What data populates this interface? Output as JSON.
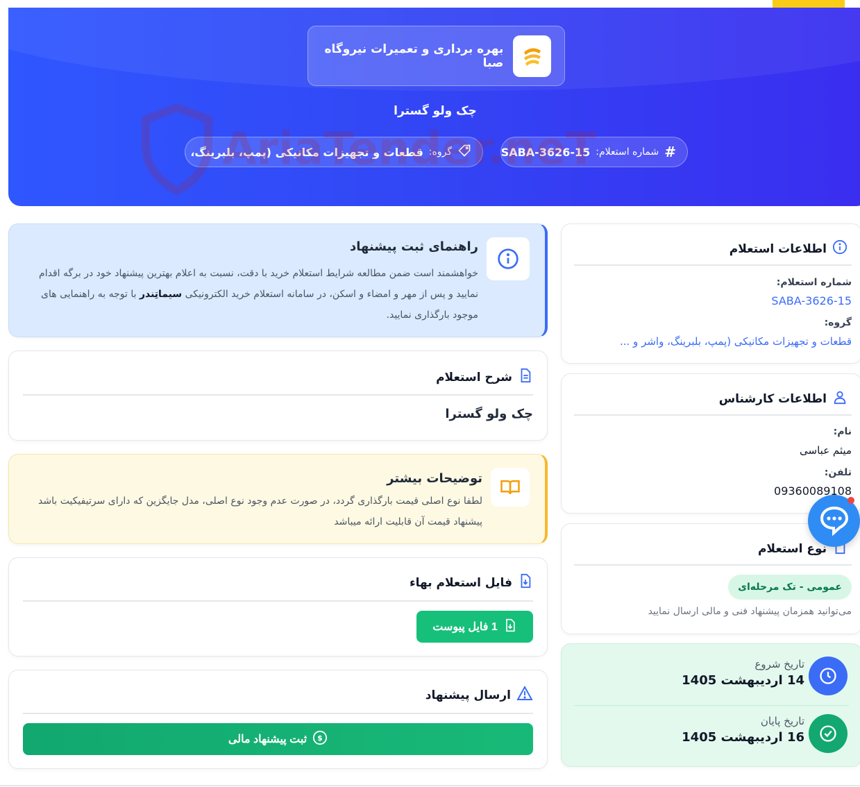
{
  "hero": {
    "company_name": "بهره برداری و تعمیرات نیروگاه صبا",
    "subject": "چک ولو گسترا",
    "number_label": "شماره استعلام:",
    "number_value": "SABA-3626-15",
    "group_label": "گروه:",
    "group_value": "قطعات و تجهیزات مکانیکی (پمپ، بلبرینگ، واشر و ..."
  },
  "watermark": "AriaTender.neT",
  "guide": {
    "title": "راهنمای ثبت پیشنهاد",
    "text_part1": "خواهشمند است ضمن مطالعه شرایط استعلام خرید با دقت، نسبت به اعلام بهترین پیشنهاد خود در برگه اقدام نمایید و پس از مهر و امضاء و اسکن، در سامانه استعلام خرید الکترونیکی",
    "brand": "سیماتِندر",
    "text_part2": "با توجه به راهنمایی های موجود بارگذاری نمایید."
  },
  "description": {
    "title": "شرح استعلام",
    "text": "چک ولو گسترا"
  },
  "more": {
    "title": "توضیحات بیشتر",
    "text": "لطفا نوع اصلی قیمت بارگذاری گردد، در صورت عدم وجود نوع اصلی، مدل جایگزین که دارای سرتیفیکیت باشد پیشنهاد قیمت آن قابلیت ارائه میباشد"
  },
  "file": {
    "title": "فایل استعلام بهاء",
    "button": "1 فایل پیوست"
  },
  "send": {
    "title": "ارسال پیشنهاد",
    "button": "ثبت پیشنهاد مالی"
  },
  "info": {
    "title": "اطلاعات استعلام",
    "number_label": "شماره استعلام:",
    "number_value": "SABA-3626-15",
    "group_label": "گروه:",
    "group_value": "قطعات و تجهیزات مکانیکی (پمپ، بلبرینگ، واشر و ..."
  },
  "expert": {
    "title": "اطلاعات کارشناس",
    "name_label": "نام:",
    "name_value": "میثم عباسی",
    "phone_label": "تلفن:",
    "phone_value": "09360089108"
  },
  "type": {
    "title": "نوع استعلام",
    "badge": "عمومی - تک مرحله‌ای",
    "note": "می‌توانید همزمان پیشنهاد فنی و مالی ارسال نمایید"
  },
  "dates": {
    "start_label": "تاریخ شروع",
    "start_value": "14 اردیبهشت 1405",
    "end_label": "تاریخ پایان",
    "end_value": "16 اردیبهشت 1405"
  },
  "colors": {
    "primary": "#3247f5",
    "accent_yellow": "#facc15",
    "success": "#16c07a",
    "link": "#3b6cf6"
  }
}
